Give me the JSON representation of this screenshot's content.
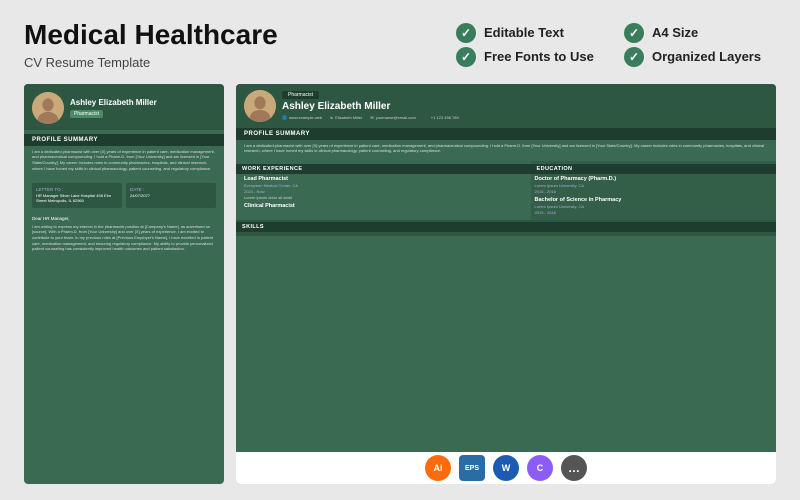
{
  "header": {
    "main_title": "Medical Healthcare",
    "sub_title": "CV Resume Template",
    "features": [
      {
        "label": "Editable Text"
      },
      {
        "label": "A4 Size"
      },
      {
        "label": "Free Fonts to Use"
      },
      {
        "label": "Organized Layers"
      }
    ]
  },
  "resume_left": {
    "name": "Ashley Elizabeth Miller",
    "role": "Pharmacist",
    "sections": {
      "profile_summary": "PROFILE SUMMARY",
      "profile_text": "I am a dedicated pharmacist with over [X] years of experience in patient care, medication management, and pharmaceutical compounding. I hold a Pharm.D. from [Your University] and am licensed in [Your State/Country]. My career includes roles in community pharmacies, hospitals, and clinical research, where I have honed my skills in clinical pharmacology, patient counseling, and regulatory compliance.",
      "letter_to_label": "LETTER TO :",
      "letter_to_value": "HR Manager\nSilver Lake Hospital\n456 Elm Street Metropolis, IL 62960",
      "date_label": "DATE :",
      "date_value": "24/07/2077",
      "dear": "Dear HR Manager,",
      "letter_body": "I am writing to express my interest in the pharmacist position at [Company's Name], as advertised on [source]. With a Pharm.D. from [Your University] and over [X] years of experience, I am excited to contribute to your team.\nIn my previous roles at [Previous Employer's Name], I have excelled in patient care, medication management, and ensuring regulatory compliance. My ability to provide personalized patient counseling has consistently improved health outcomes and patient satisfaction."
    }
  },
  "resume_right": {
    "pharmacist_badge": "Pharmacist",
    "name": "Ashley Elizabeth Miller",
    "contacts": [
      {
        "label": "www.example.web"
      },
      {
        "label": "Elizabeth Miller"
      },
      {
        "label": "yourname@email.com"
      },
      {
        "label": "+1 123 456 789"
      }
    ],
    "profile_summary": "PROFILE SUMMARY",
    "profile_text": "I am a dedicated pharmacist with over [X] years of experience in patient care, medication management, and pharmaceutical compounding. I hold a Pharm.D. from [Your University] and am licensed in [Your State/Country]. My career includes roles in community pharmacies, hospitals, and clinical research, where I have honed my skills in clinical pharmacology, patient counseling, and regulatory compliance.",
    "work_experience": "WORK EXPERIENCE",
    "education": "EDUCATION",
    "skills": "SKILLS",
    "jobs": [
      {
        "title": "Lead Pharmacist",
        "company": "Evergreen Medical Center, CA",
        "period": "2023 - Now",
        "desc": "Lorem ipsum dolor sit amet"
      },
      {
        "title": "Clinical Pharmacist",
        "company": "",
        "period": "",
        "desc": ""
      }
    ],
    "education_items": [
      {
        "degree": "Doctor of Pharmacy (Pharm.D.)",
        "school": "Lorem Ipsum University, CA",
        "period": "2015 - 2018"
      },
      {
        "degree": "Bachelor of Science in Pharmacy",
        "school": "Lorem Ipsum University, CA",
        "period": "2015 - 2018"
      }
    ]
  },
  "tools": [
    {
      "label": "Ai",
      "type": "ai"
    },
    {
      "label": "EPS",
      "type": "eps"
    },
    {
      "label": "W",
      "type": "word"
    },
    {
      "label": "C",
      "type": "canva"
    },
    {
      "label": "...",
      "type": "more"
    }
  ]
}
